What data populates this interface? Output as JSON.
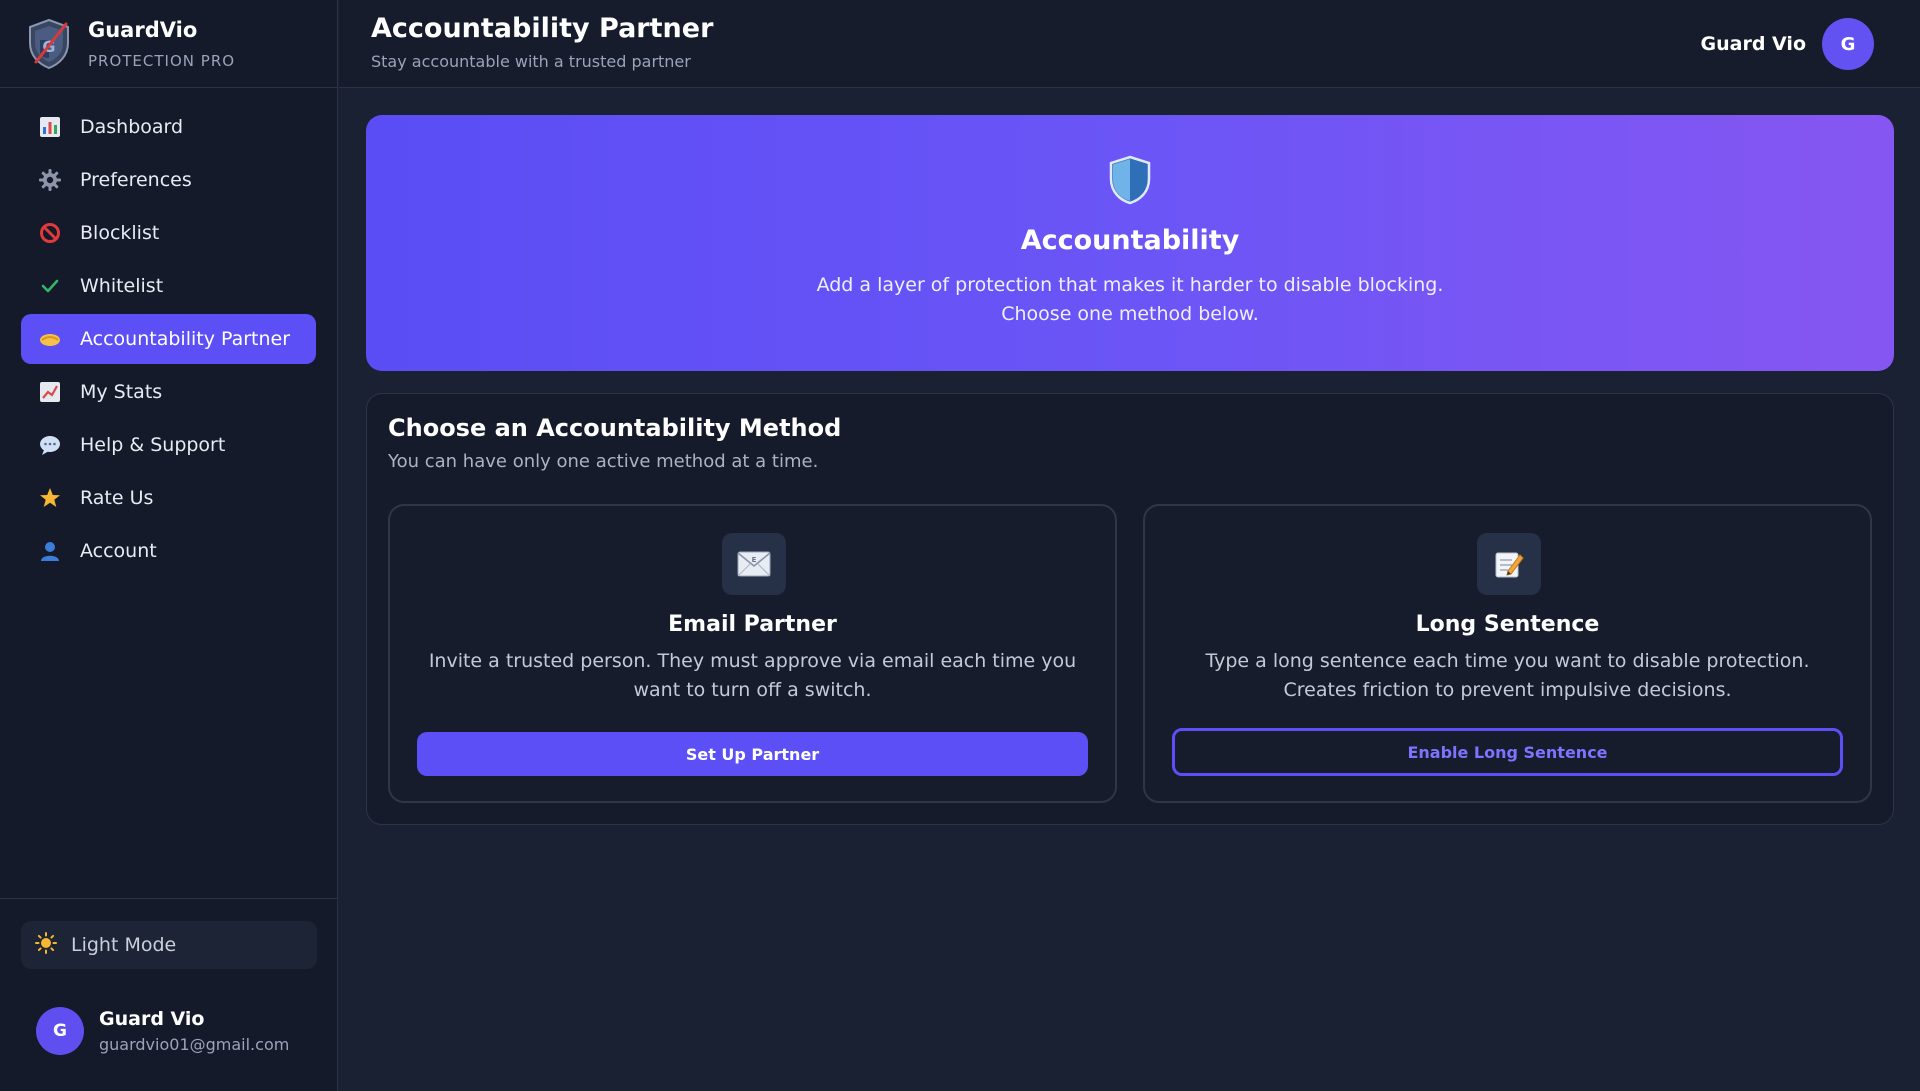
{
  "brand": {
    "name": "GuardVio",
    "subtitle": "PROTECTION PRO",
    "logo_icon": "shield-logo-icon"
  },
  "sidebar": {
    "items": [
      {
        "label": "Dashboard",
        "icon": "bar-chart-icon"
      },
      {
        "label": "Preferences",
        "icon": "gear-icon"
      },
      {
        "label": "Blocklist",
        "icon": "prohibited-icon"
      },
      {
        "label": "Whitelist",
        "icon": "checkmark-icon"
      },
      {
        "label": "Accountability Partner",
        "icon": "handshake-icon",
        "active": true
      },
      {
        "label": "My Stats",
        "icon": "trending-chart-icon"
      },
      {
        "label": "Help & Support",
        "icon": "speech-bubble-icon"
      },
      {
        "label": "Rate Us",
        "icon": "star-icon"
      },
      {
        "label": "Account",
        "icon": "user-icon"
      }
    ],
    "theme_toggle": {
      "label": "Light Mode",
      "icon": "sun-icon"
    },
    "user": {
      "initial": "G",
      "name": "Guard Vio",
      "email": "guardvio01@gmail.com"
    }
  },
  "header": {
    "title": "Accountability Partner",
    "subtitle": "Stay accountable with a trusted partner",
    "user_name": "Guard Vio",
    "user_initial": "G"
  },
  "hero": {
    "icon": "shield-icon",
    "title": "Accountability",
    "description_line1": "Add a layer of protection that makes it harder to disable blocking.",
    "description_line2": "Choose one method below."
  },
  "methods": {
    "title": "Choose an Accountability Method",
    "subtitle": "You can have only one active method at a time.",
    "cards": [
      {
        "icon": "envelope-icon",
        "title": "Email Partner",
        "description": "Invite a trusted person. They must approve via email each time you want to turn off a switch.",
        "button_label": "Set Up Partner"
      },
      {
        "icon": "memo-pencil-icon",
        "title": "Long Sentence",
        "description": "Type a long sentence each time you want to disable protection. Creates friction to prevent impulsive decisions.",
        "button_label": "Enable Long Sentence"
      }
    ]
  },
  "colors": {
    "accent": "#5b4ff5",
    "background": "#1a2133",
    "sidebar": "#141a2a",
    "hero_gradient_start": "#5a4df5",
    "hero_gradient_end": "#8656f2"
  }
}
